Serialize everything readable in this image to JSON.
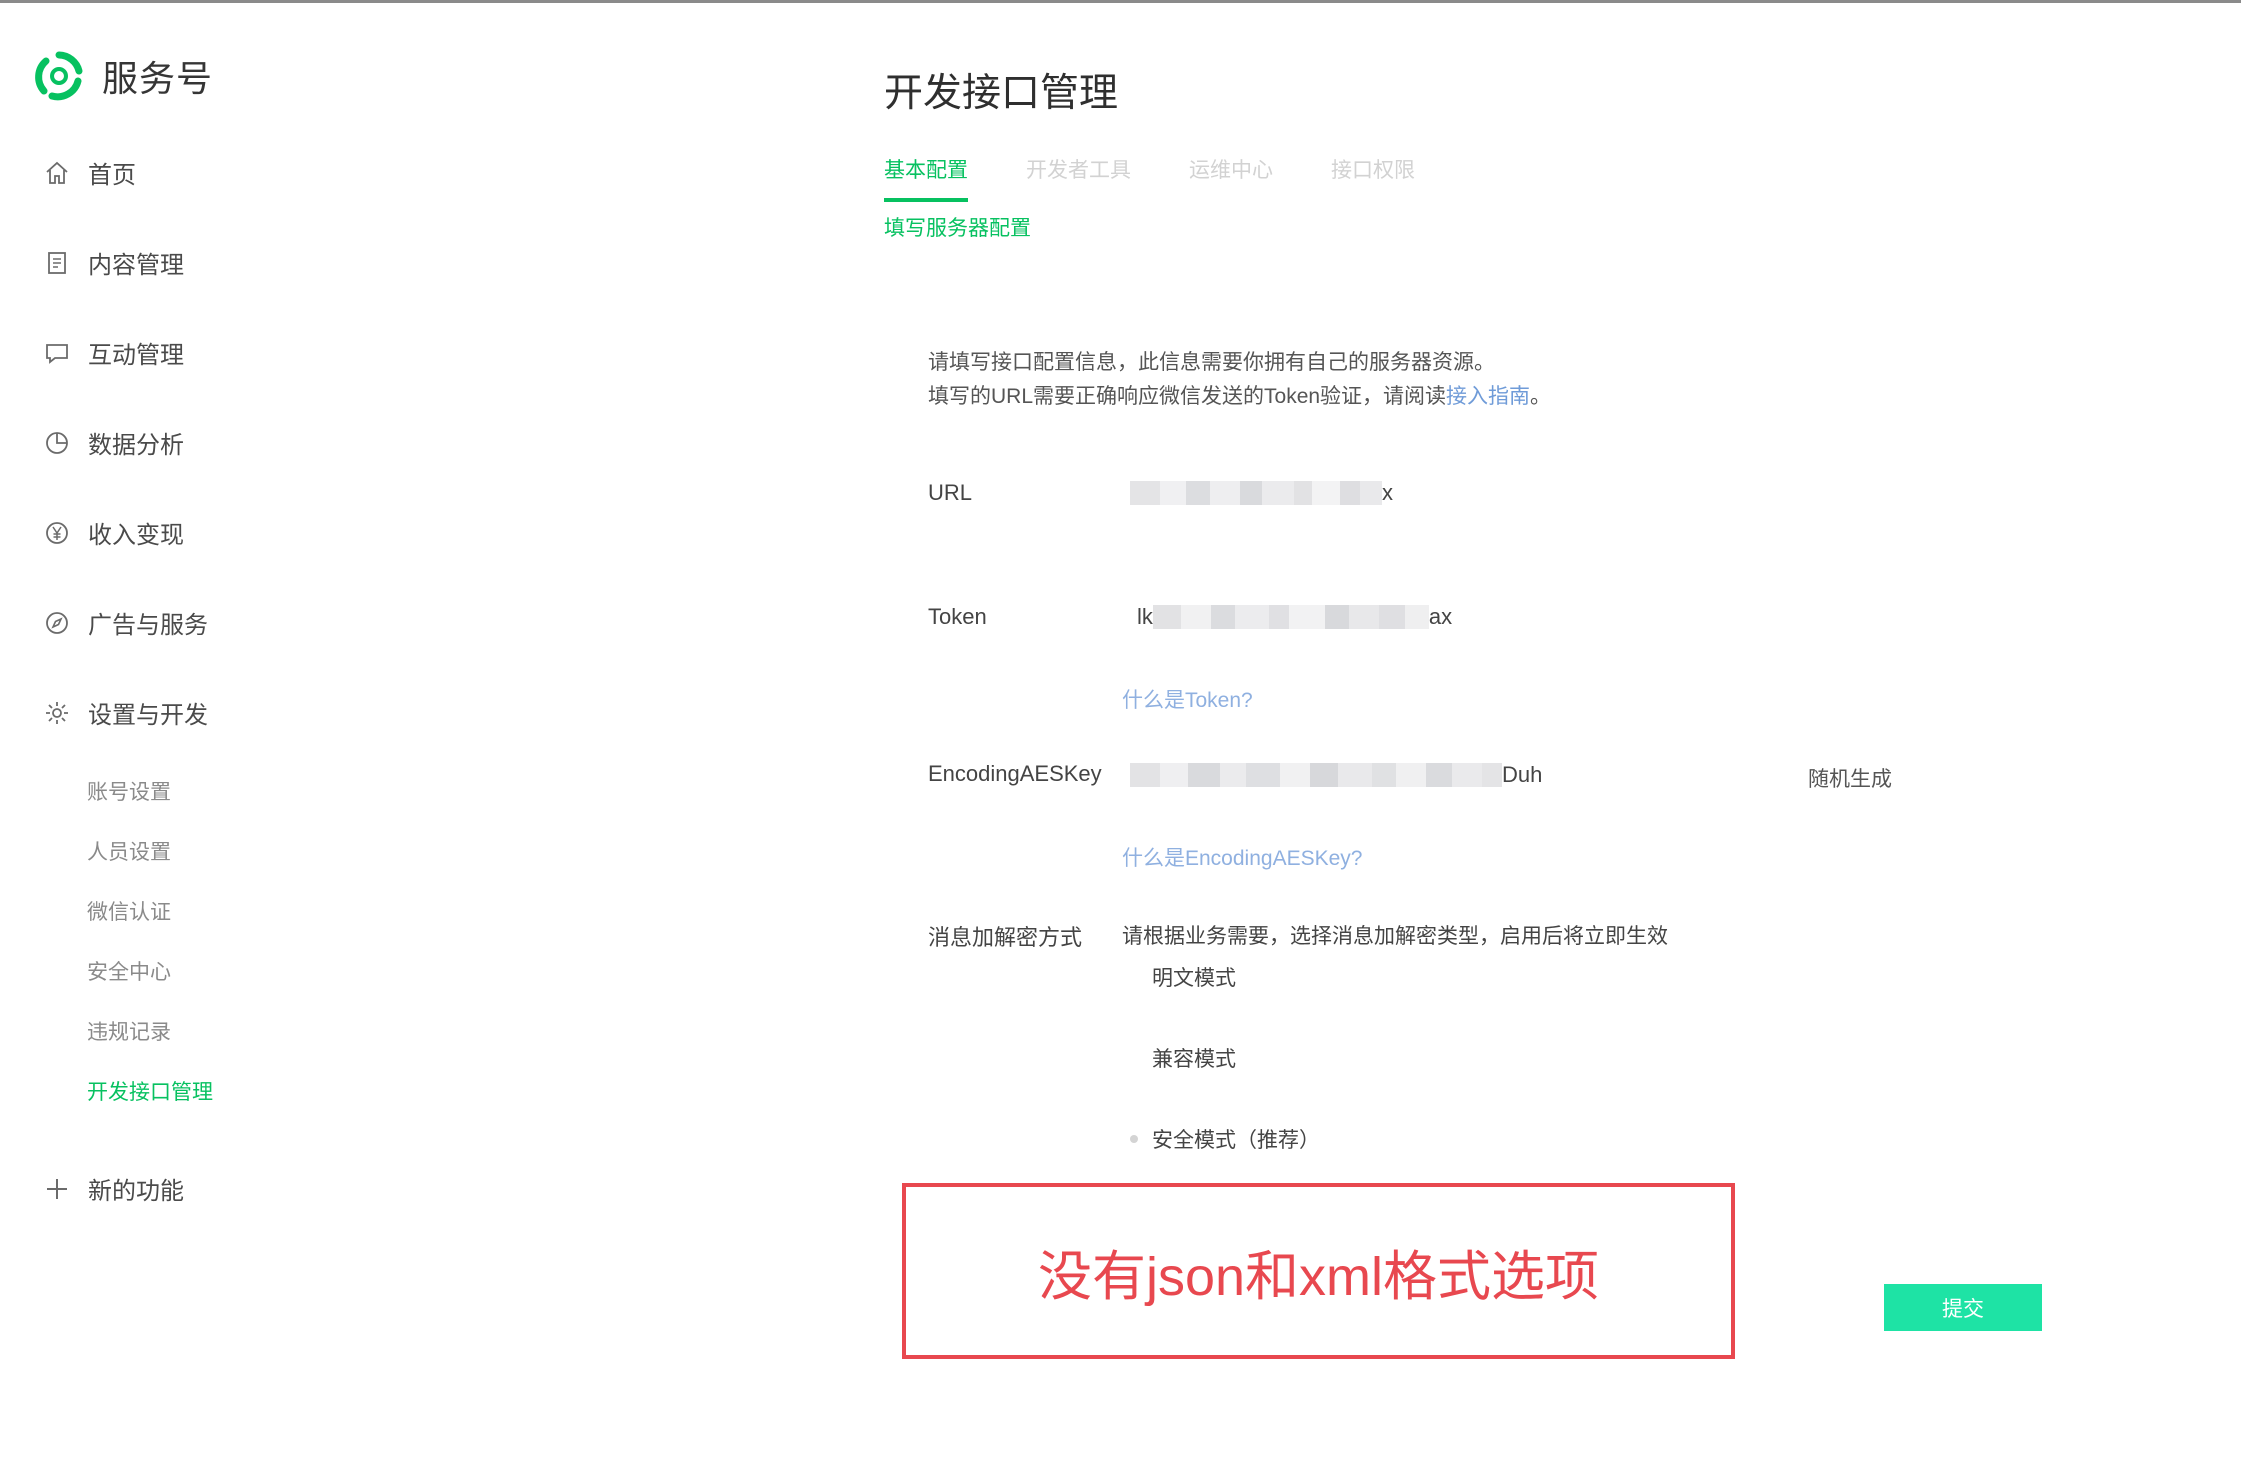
{
  "brand": {
    "name": "服务号",
    "logo_icon": "wechat-service-logo-icon",
    "color": "#07c160"
  },
  "sidebar": {
    "items": [
      {
        "label": "首页",
        "icon": "home-icon"
      },
      {
        "label": "内容管理",
        "icon": "document-icon"
      },
      {
        "label": "互动管理",
        "icon": "chat-bubble-icon"
      },
      {
        "label": "数据分析",
        "icon": "pie-chart-icon"
      },
      {
        "label": "收入变现",
        "icon": "yen-circle-icon"
      },
      {
        "label": "广告与服务",
        "icon": "compass-icon"
      },
      {
        "label": "设置与开发",
        "icon": "gear-icon"
      }
    ],
    "sub_items": [
      {
        "label": "账号设置"
      },
      {
        "label": "人员设置"
      },
      {
        "label": "微信认证"
      },
      {
        "label": "安全中心"
      },
      {
        "label": "违规记录"
      },
      {
        "label": "开发接口管理",
        "active": true
      }
    ],
    "new_feature": {
      "label": "新的功能",
      "icon": "plus-icon"
    }
  },
  "main": {
    "title": "开发接口管理",
    "tabs": [
      {
        "label": "基本配置",
        "active": true
      },
      {
        "label": "开发者工具"
      },
      {
        "label": "运维中心"
      },
      {
        "label": "接口权限"
      }
    ],
    "subnav": "填写服务器配置",
    "intro": {
      "line1": "请填写接口配置信息，此信息需要你拥有自己的服务器资源。",
      "line2_prefix": "填写的URL需要正确响应微信发送的Token验证，请阅读",
      "line2_link": "接入指南",
      "line2_suffix": "。"
    },
    "fields": {
      "url": {
        "label": "URL",
        "value_suffix": "x"
      },
      "token": {
        "label": "Token",
        "value_prefix": "lk",
        "value_suffix": "ax",
        "help": "什么是Token?"
      },
      "aes": {
        "label": "EncodingAESKey",
        "value_suffix": "Duh",
        "generate": "随机生成",
        "help": "什么是EncodingAESKey?"
      }
    },
    "encryption": {
      "label": "消息加解密方式",
      "description": "请根据业务需要，选择消息加解密类型，启用后将立即生效",
      "options": [
        {
          "label": "明文模式"
        },
        {
          "label": "兼容模式"
        },
        {
          "label": "安全模式（推荐）"
        }
      ]
    },
    "annotation": {
      "text": "没有json和xml格式选项",
      "color": "#e8484f"
    },
    "submit_label": "提交",
    "accent": "#1ee3a5"
  }
}
